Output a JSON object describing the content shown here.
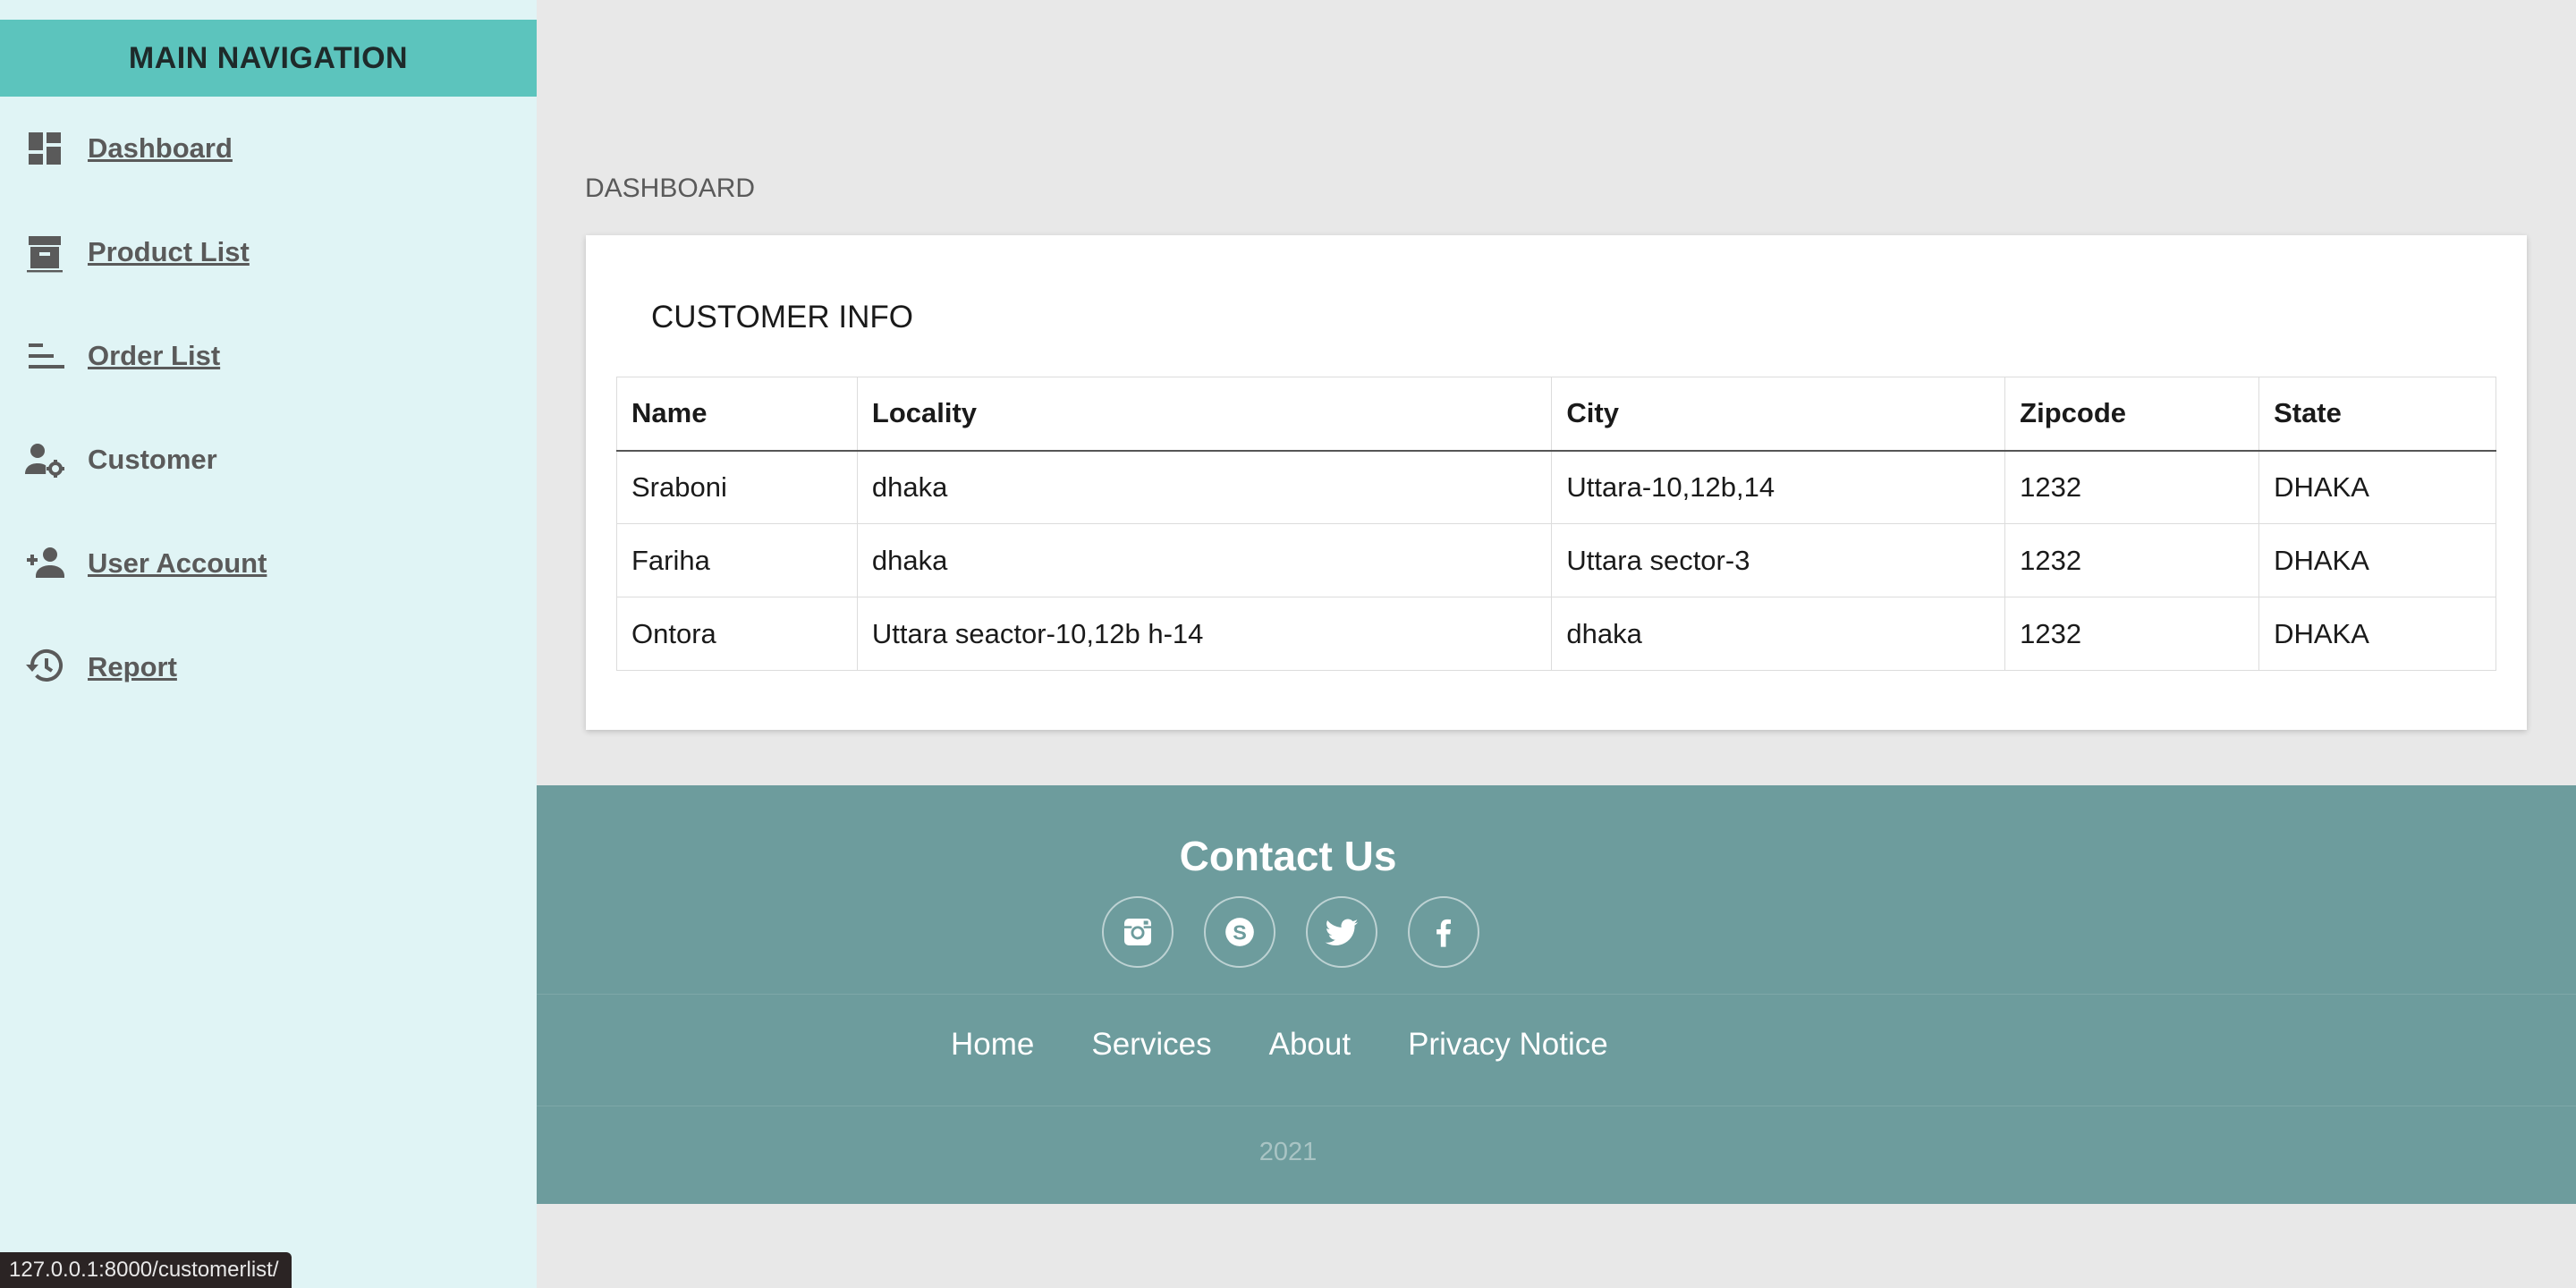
{
  "sidebar": {
    "header": "MAIN NAVIGATION",
    "items": [
      {
        "label": "Dashboard",
        "icon": "dashboard-icon"
      },
      {
        "label": "Product List",
        "icon": "archive-box-icon"
      },
      {
        "label": "Order List",
        "icon": "sort-lines-icon"
      },
      {
        "label": "Customer",
        "icon": "person-gear-icon"
      },
      {
        "label": "User Account",
        "icon": "person-add-icon"
      },
      {
        "label": "Report",
        "icon": "history-icon"
      }
    ]
  },
  "main": {
    "page_title": "DASHBOARD",
    "card_title": "CUSTOMER INFO",
    "table": {
      "headers": [
        "Name",
        "Locality",
        "City",
        "Zipcode",
        "State"
      ],
      "rows": [
        [
          "Sraboni",
          "dhaka",
          "Uttara-10,12b,14",
          "1232",
          "DHAKA"
        ],
        [
          "Fariha",
          "dhaka",
          "Uttara sector-3",
          "1232",
          "DHAKA"
        ],
        [
          "Ontora",
          "Uttara seactor-10,12b h-14",
          "dhaka",
          "1232",
          "DHAKA"
        ]
      ]
    }
  },
  "footer": {
    "title": "Contact Us",
    "socials": [
      "instagram-icon",
      "skype-icon",
      "twitter-icon",
      "facebook-icon"
    ],
    "links": [
      "Home",
      "Services",
      "About",
      "Privacy Notice"
    ],
    "year": "2021"
  },
  "status_bar": {
    "url": "127.0.0.1:8000/customerlist/"
  },
  "colors": {
    "sidebar_bg": "#e0f4f5",
    "sidebar_header": "#5cc4bd",
    "footer_bg": "#6d9c9d",
    "page_bg": "#e8e8e8"
  }
}
